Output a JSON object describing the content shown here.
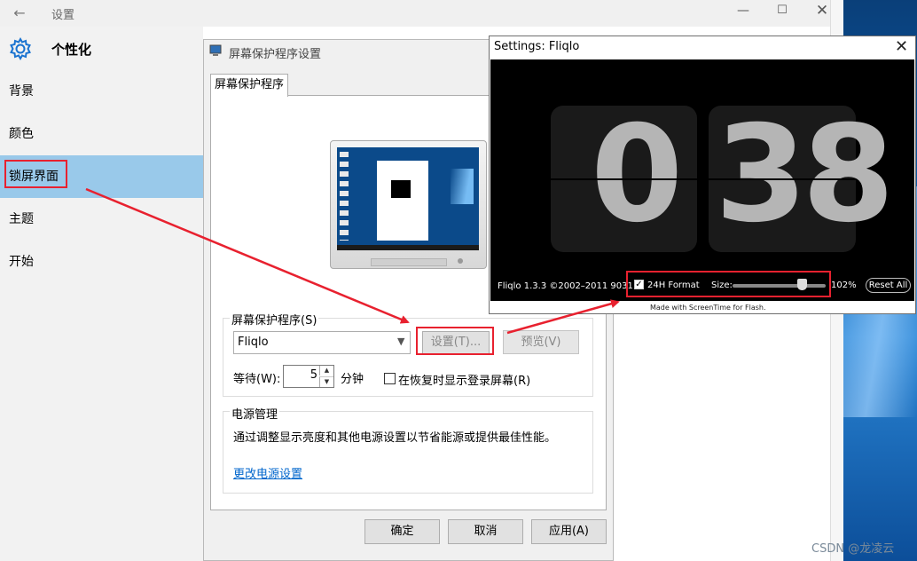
{
  "settings": {
    "title": "设置",
    "category": "个性化",
    "nav_items": [
      "背景",
      "颜色",
      "锁屏界面",
      "主题",
      "开始"
    ],
    "active_item": "锁屏界面"
  },
  "screensaver_dialog": {
    "title": "屏幕保护程序设置",
    "tab": "屏幕保护程序",
    "group_label": "屏幕保护程序(S)",
    "selected": "Fliqlo",
    "settings_button": "设置(T)...",
    "preview_button": "预览(V)",
    "wait_label": "等待(W):",
    "wait_value": "5",
    "minutes": "分钟",
    "resume_label": "在恢复时显示登录屏幕(R)",
    "resume_checked": false,
    "power_group_label": "电源管理",
    "power_desc": "通过调整显示亮度和其他电源设置以节省能源或提供最佳性能。",
    "power_link": "更改电源设置",
    "ok": "确定",
    "cancel": "取消",
    "apply": "应用(A)"
  },
  "fliqlo": {
    "title": "Settings: Fliqlo",
    "hour": "0",
    "minute": "38",
    "version": "Fliqlo 1.3.3 ©2002–2011 9031",
    "format_label": "24H Format",
    "format_checked": true,
    "size_label": "Size:",
    "size_percent": 102,
    "size_text": "102%",
    "reset": "Reset All",
    "made_with": "Made with ScreenTime for Flash."
  },
  "watermark": "CSDN @龙凌云",
  "colors": {
    "highlight": "#e8212f",
    "active_nav": "#99c9ea",
    "link": "#0066cc"
  }
}
